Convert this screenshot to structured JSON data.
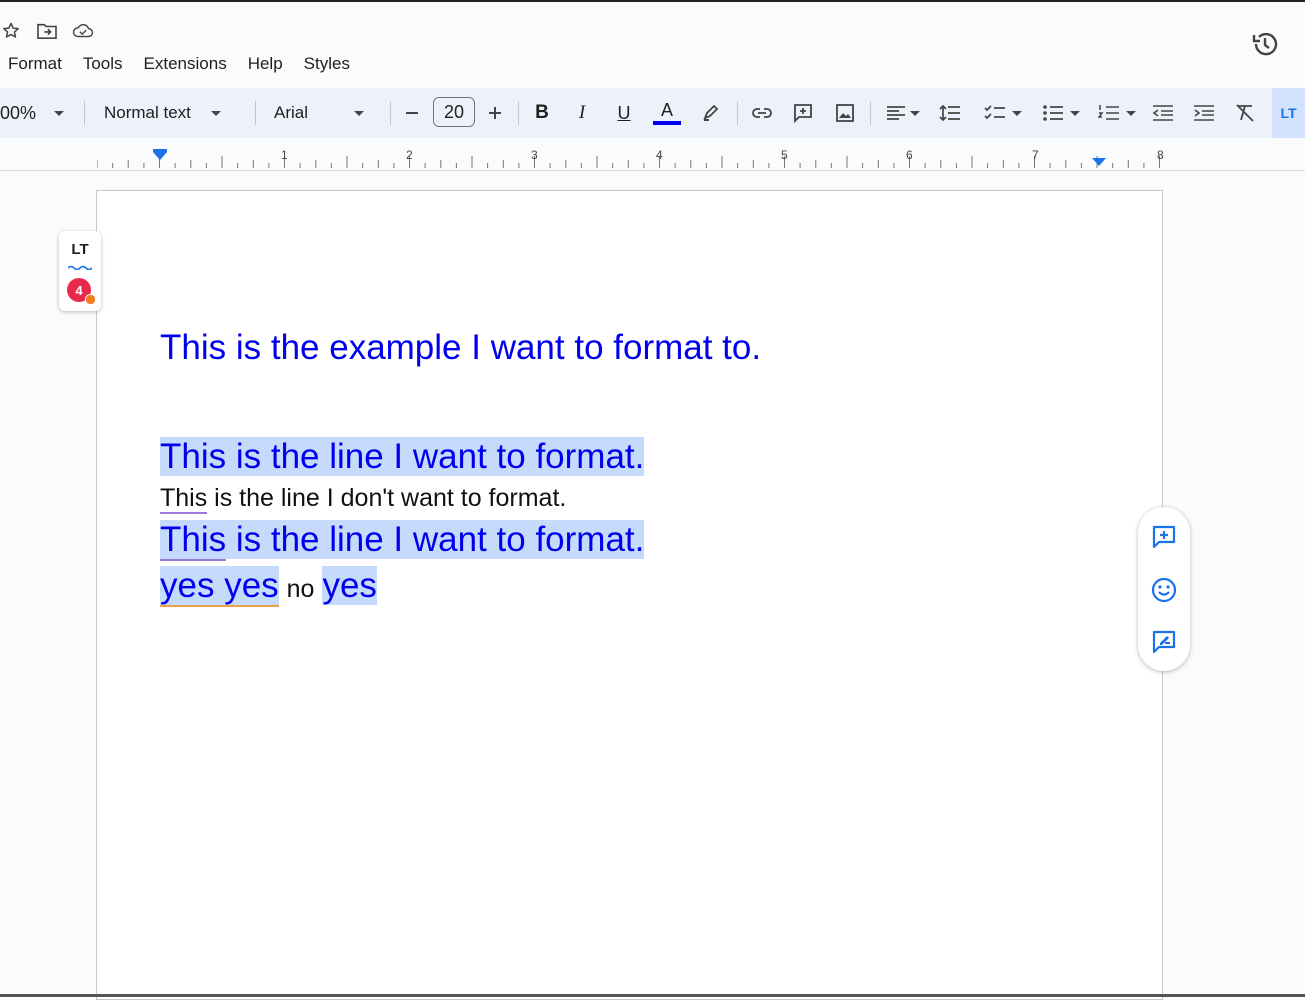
{
  "menu": {
    "items": [
      "Format",
      "Tools",
      "Extensions",
      "Help",
      "Styles"
    ]
  },
  "toolbar": {
    "zoom": "00%",
    "style": "Normal text",
    "font": "Arial",
    "font_size": "20",
    "text_color": "#0000ee"
  },
  "ruler": {
    "numbers": [
      "1",
      "2",
      "3",
      "4",
      "5",
      "6",
      "7",
      "8"
    ]
  },
  "lt_panel": {
    "logo": "LT",
    "badge_count": "4"
  },
  "document": {
    "line1": "This is the example I want to format to.",
    "line2": "This is the line I want to format.",
    "line3_part1": "This",
    "line3_part2": " is the line I don't want to format.",
    "line4_part1": "This",
    "line4_part2": " is the line I want to format.",
    "line5_part1": "yes yes",
    "line5_part2": "no",
    "line5_part3": "yes"
  },
  "colors": {
    "selection": "#c6dafc",
    "text_blue": "#0000ee",
    "accent": "#1a73e8"
  }
}
